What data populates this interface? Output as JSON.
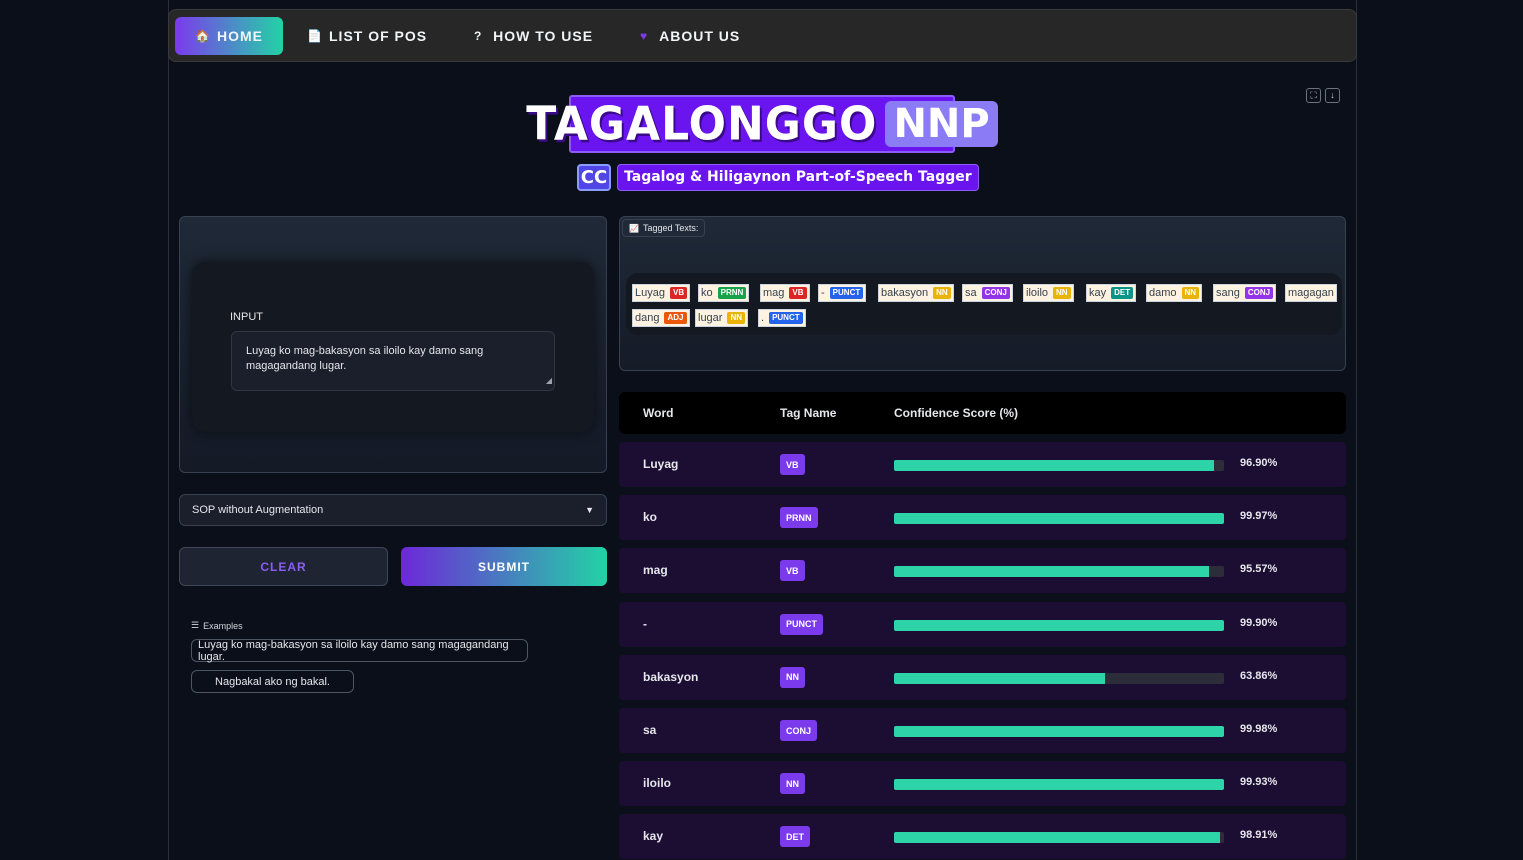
{
  "nav": {
    "items": [
      {
        "label": "HOME",
        "icon": "house-icon",
        "active": true
      },
      {
        "label": "LIST OF POS",
        "icon": "document-icon",
        "active": false
      },
      {
        "label": "HOW TO USE",
        "icon": "question-icon",
        "active": false
      },
      {
        "label": "ABOUT US",
        "icon": "hearts-icon",
        "active": false
      }
    ]
  },
  "logo": {
    "main": "TAGALONGGO",
    "badge": "NNP",
    "cc": "CC",
    "subtitle": "Tagalog & Hiligaynon Part-of-Speech Tagger"
  },
  "input": {
    "label": "INPUT",
    "value": "Luyag ko mag-bakasyon sa iloilo kay damo sang magagandang lugar."
  },
  "model_select": {
    "value": "SOP without Augmentation"
  },
  "buttons": {
    "clear": "CLEAR",
    "submit": "SUBMIT"
  },
  "examples": {
    "label": "Examples",
    "items": [
      "Luyag ko mag-bakasyon sa iloilo kay damo sang magagandang lugar.",
      "Nagbakal ako ng bakal."
    ]
  },
  "tagged": {
    "label": "Tagged Texts:",
    "tokens": [
      {
        "word": "Luyag",
        "tag": "VB"
      },
      {
        "word": "ko",
        "tag": "PRNN"
      },
      {
        "word": "mag",
        "tag": "VB"
      },
      {
        "word": "-",
        "tag": "PUNCT"
      },
      {
        "word": "bakasyon",
        "tag": "NN"
      },
      {
        "word": "sa",
        "tag": "CONJ"
      },
      {
        "word": "iloilo",
        "tag": "NN"
      },
      {
        "word": "kay",
        "tag": "DET"
      },
      {
        "word": "damo",
        "tag": "NN"
      },
      {
        "word": "sang",
        "tag": "CONJ"
      },
      {
        "word": "magagan",
        "tag": ""
      },
      {
        "word": "dang",
        "tag": "ADJ"
      },
      {
        "word": "lugar",
        "tag": "NN"
      },
      {
        "word": ".",
        "tag": "PUNCT"
      }
    ],
    "tag_colors": {
      "VB": "#dc2626",
      "PRNN": "#16a34a",
      "PUNCT": "#2563eb",
      "NN": "#eab308",
      "CONJ": "#9333ea",
      "DET": "#0d9488",
      "ADJ": "#ea580c"
    }
  },
  "table": {
    "headers": {
      "word": "Word",
      "tag": "Tag Name",
      "score": "Confidence Score (%)"
    },
    "rows": [
      {
        "word": "Luyag",
        "tag": "VB",
        "score": 96.9,
        "score_label": "96.90%"
      },
      {
        "word": "ko",
        "tag": "PRNN",
        "score": 99.97,
        "score_label": "99.97%"
      },
      {
        "word": "mag",
        "tag": "VB",
        "score": 95.57,
        "score_label": "95.57%"
      },
      {
        "word": "-",
        "tag": "PUNCT",
        "score": 99.9,
        "score_label": "99.90%"
      },
      {
        "word": "bakasyon",
        "tag": "NN",
        "score": 63.86,
        "score_label": "63.86%"
      },
      {
        "word": "sa",
        "tag": "CONJ",
        "score": 99.98,
        "score_label": "99.98%"
      },
      {
        "word": "iloilo",
        "tag": "NN",
        "score": 99.93,
        "score_label": "99.93%"
      },
      {
        "word": "kay",
        "tag": "DET",
        "score": 98.91,
        "score_label": "98.91%"
      }
    ]
  }
}
